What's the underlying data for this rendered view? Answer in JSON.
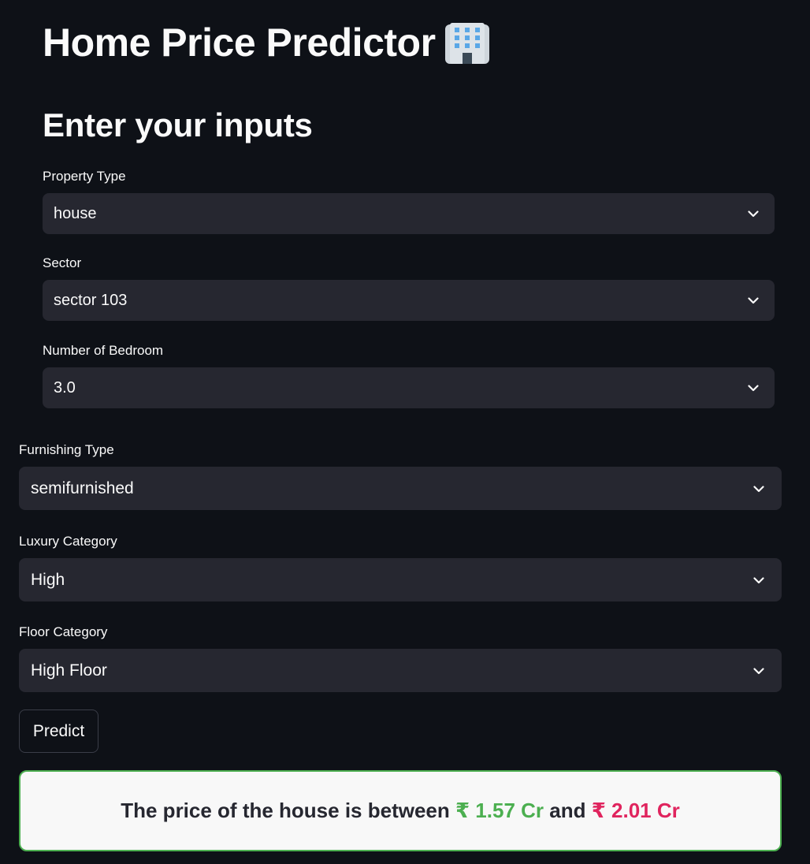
{
  "app": {
    "title": "Home Price Predictor",
    "title_icon": "office-building-icon"
  },
  "section": {
    "title": "Enter your inputs"
  },
  "fields": {
    "property_type": {
      "label": "Property Type",
      "value": "house"
    },
    "sector": {
      "label": "Sector",
      "value": "sector 103"
    },
    "bedrooms": {
      "label": "Number of Bedroom",
      "value": "3.0"
    },
    "furnishing_type": {
      "label": "Furnishing Type",
      "value": "semifurnished"
    },
    "luxury_category": {
      "label": "Luxury Category",
      "value": "High"
    },
    "floor_category": {
      "label": "Floor Category",
      "value": "High Floor"
    }
  },
  "predict_button": {
    "label": "Predict"
  },
  "result": {
    "prefix": "The price of the house is between ",
    "low_price": "₹ 1.57 Cr",
    "connector": " and ",
    "high_price": "₹ 2.01 Cr",
    "low_color": "#4caf50",
    "high_color": "#e0245e",
    "border_color": "#4caf50"
  },
  "colors": {
    "background": "#0e1117",
    "input_bg": "#262730",
    "text": "#fafafa"
  }
}
